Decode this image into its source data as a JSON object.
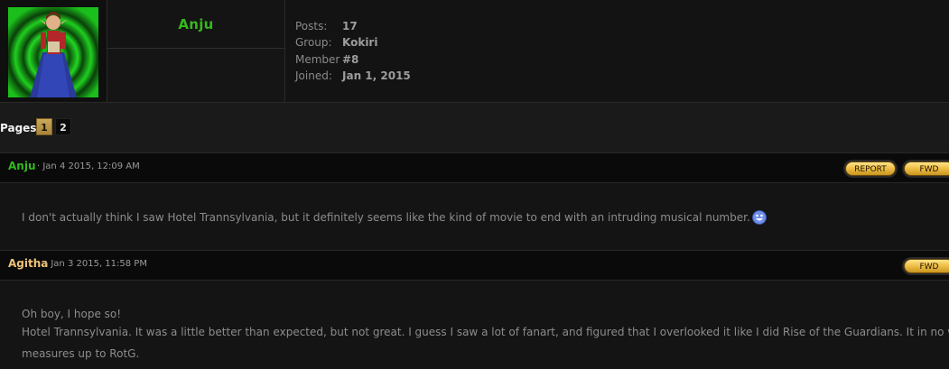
{
  "profile": {
    "username": "Anju",
    "stats": [
      {
        "label": "Posts:",
        "value": "17"
      },
      {
        "label": "Group:",
        "value": "Kokiri"
      },
      {
        "label": "Member",
        "value": "#8"
      },
      {
        "label": "Joined:",
        "value": "Jan 1, 2015"
      }
    ],
    "colors": {
      "username": "#34b81d"
    }
  },
  "pagination": {
    "label": "Pages:",
    "pages": [
      "1",
      "2"
    ],
    "current": "1"
  },
  "posts": [
    {
      "author": "Anju",
      "author_color": "#34b81d",
      "date": "· Jan 4 2015, 12:09 AM",
      "buttons": [
        "REPORT",
        "FWD"
      ],
      "lines": [
        "I don't actually think I saw Hotel Trannsylvania, but it definitely seems like the kind of movie to end with an intruding musical number."
      ],
      "has_smiley": true
    },
    {
      "author": "Agitha",
      "author_color": "#f0c277",
      "date": "· Jan 3 2015, 11:58 PM",
      "buttons": [
        "FWD"
      ],
      "lines": [
        "Oh boy, I hope so!",
        "Hotel Trannsylvania. It was a little better than expected, but not great. I guess I saw a lot of fanart, and figured that I overlooked it like I did Rise of the Guardians. It in no way",
        "measures up to RotG."
      ],
      "has_smiley": false
    }
  ]
}
